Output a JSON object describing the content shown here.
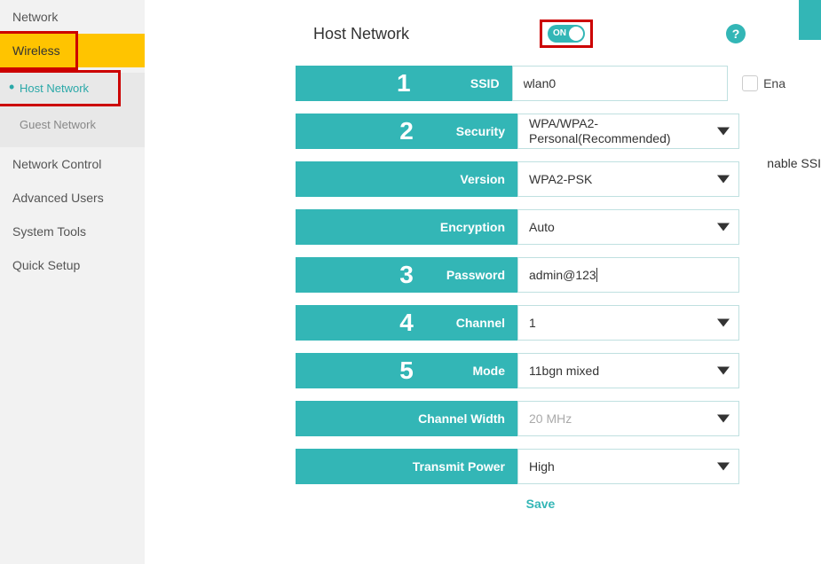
{
  "sidebar": {
    "network": "Network",
    "wireless": "Wireless",
    "host_network": "Host Network",
    "guest_network": "Guest Network",
    "network_control": "Network Control",
    "advanced_users": "Advanced Users",
    "system_tools": "System Tools",
    "quick_setup": "Quick Setup"
  },
  "header": {
    "title": "Host Network",
    "toggle_label": "ON",
    "help": "?"
  },
  "form": {
    "ssid": {
      "num": "1",
      "label": "SSID",
      "value": "wlan0",
      "enable": "Ena"
    },
    "security": {
      "num": "2",
      "label": "Security",
      "value": "WPA/WPA2-Personal(Recommended)"
    },
    "version": {
      "label": "Version",
      "value": "WPA2-PSK"
    },
    "encryption": {
      "label": "Encryption",
      "value": "Auto"
    },
    "password": {
      "num": "3",
      "label": "Password",
      "value": "admin@123"
    },
    "channel": {
      "num": "4",
      "label": "Channel",
      "value": "1"
    },
    "mode": {
      "num": "5",
      "label": "Mode",
      "value": "11bgn mixed"
    },
    "channel_width": {
      "label": "Channel Width",
      "value": "20 MHz"
    },
    "transmit_power": {
      "label": "Transmit Power",
      "value": "High"
    }
  },
  "extra": {
    "enable_ssid": "nable SSI"
  },
  "actions": {
    "save": "Save"
  }
}
